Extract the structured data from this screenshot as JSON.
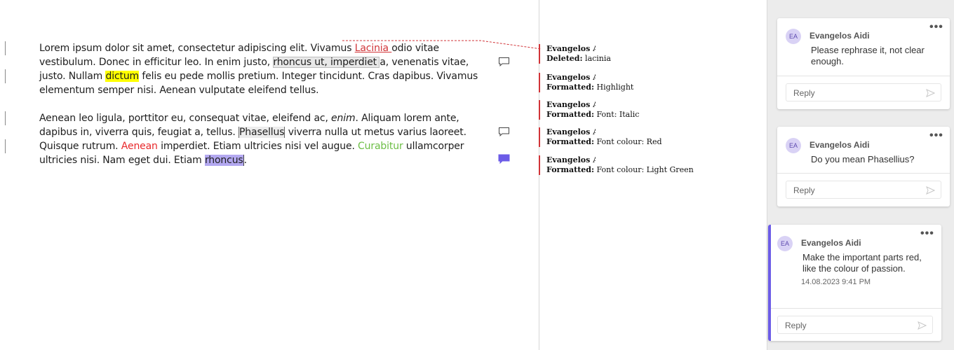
{
  "document": {
    "paragraph1": {
      "t1": "Lorem ipsum dolor sit amet, consectetur adipiscing elit. Vivamus ",
      "deleted": "Lacinia ",
      "t2": "odio vitae vestibulum. Donec in efficitur leo. In enim justo, ",
      "commented1": "rhoncus ut, imperdiet ",
      "t3": "a, venenatis vitae, justo. Nullam ",
      "highlighted": "dictum",
      "t4": " felis eu pede mollis pretium. Integer tincidunt. Cras dapibus. Vivamus elementum semper nisi. Aenean vulputate eleifend tellus."
    },
    "paragraph2": {
      "t1": "Aenean leo ligula, porttitor eu, consequat vitae, eleifend ac, ",
      "italic": "enim",
      "t2": ". Aliquam lorem ante, dapibus in, viverra quis, feugiat a, tellus. ",
      "commented2": "Phasellus",
      "t3": " viverra nulla ut metus varius laoreet. Quisque rutrum. ",
      "red": "Aenean",
      "t4": " imperdiet. Etiam ultricies nisi vel augue. ",
      "green": "Curabitur",
      "t5": " ullamcorper ultricies nisi. Nam eget dui. Etiam ",
      "commented3": "rhoncus",
      "t6": "."
    }
  },
  "revisions": [
    {
      "author": "Evangelos Aidinis",
      "action": "Deleted:",
      "detail": "lacinia"
    },
    {
      "author": "Evangelos Aidinis",
      "action": "Formatted:",
      "detail": "Highlight"
    },
    {
      "author": "Evangelos Aidinis",
      "action": "Formatted:",
      "detail": "Font: Italic"
    },
    {
      "author": "Evangelos Aidinis",
      "action": "Formatted:",
      "detail": "Font colour: Red"
    },
    {
      "author": "Evangelos Aidinis",
      "action": "Formatted:",
      "detail": "Font colour: Light Green"
    }
  ],
  "comments": [
    {
      "initials": "EA",
      "author": "Evangelos Aidinis",
      "text": "Please rephrase it, not clear enough.",
      "reply_placeholder": "Reply",
      "more": "•••"
    },
    {
      "initials": "EA",
      "author": "Evangelos Aidinis",
      "text": "Do you mean Phasellius?",
      "reply_placeholder": "Reply",
      "more": "•••"
    },
    {
      "initials": "EA",
      "author": "Evangelos Aidinis",
      "text": "Make the important parts red, like the colour of passion.",
      "date": "14.08.2023 9:41 PM",
      "reply_placeholder": "Reply",
      "more": "•••"
    }
  ],
  "colors": {
    "deletion": "#d13438",
    "highlight": "#ffff00",
    "red_text": "#e8282b",
    "green_text": "#6cbe45",
    "active_comment": "#6c5ce7"
  }
}
